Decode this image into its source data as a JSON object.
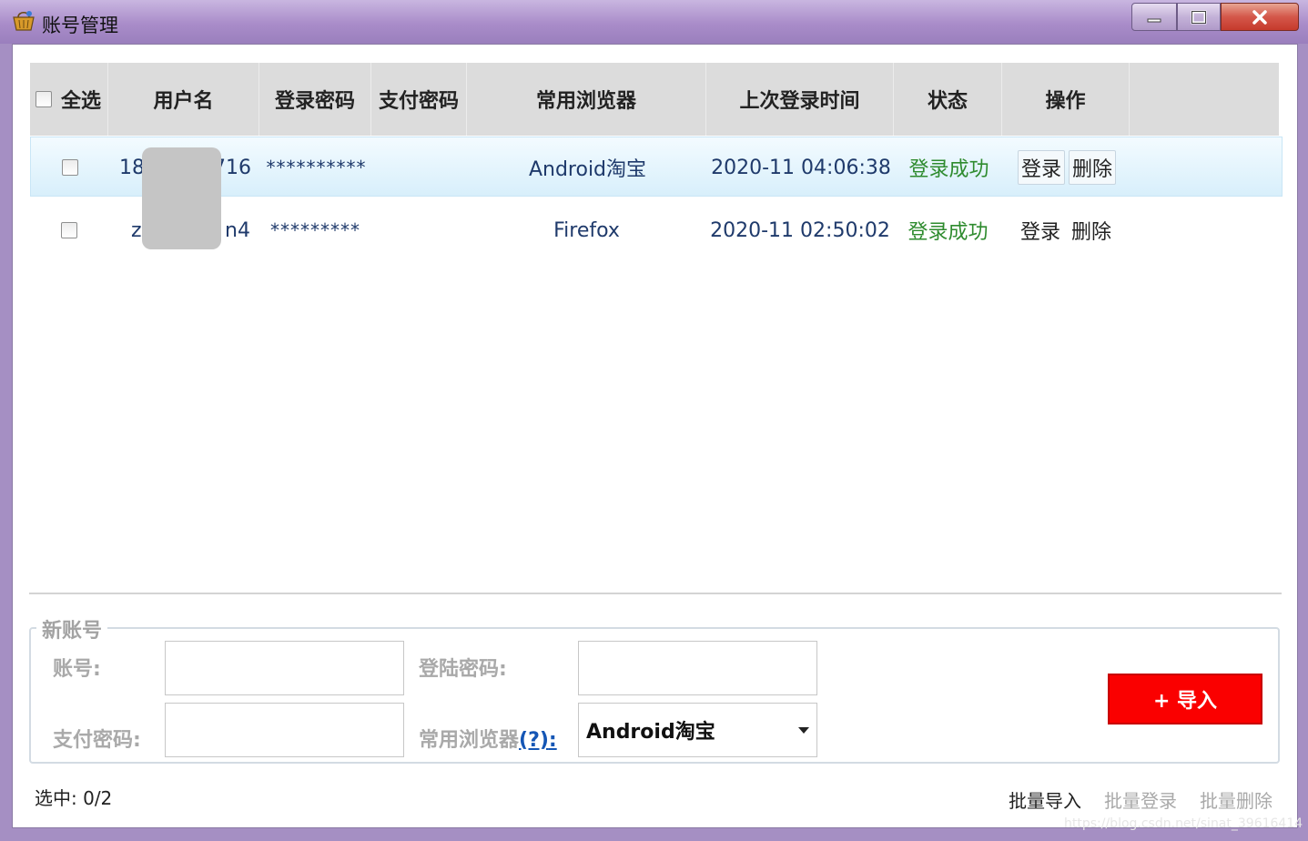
{
  "window": {
    "title": "账号管理",
    "controls": {
      "minimize": "—",
      "maximize": "▢",
      "close": "✕"
    },
    "title_icon": "basket-icon"
  },
  "table": {
    "headers": {
      "select_all": "全选",
      "username": "用户名",
      "login_password": "登录密码",
      "pay_password": "支付密码",
      "browser": "常用浏览器",
      "last_login": "上次登录时间",
      "status": "状态",
      "actions": "操作"
    },
    "rows": [
      {
        "username_start": "18",
        "username_end": "716",
        "login_password": "**********",
        "pay_password": "",
        "browser": "Android淘宝",
        "last_login": "2020-11 04:06:38",
        "status": "登录成功",
        "login_btn": "登录",
        "delete_btn": "删除"
      },
      {
        "username_start": "z",
        "username_end": "n4",
        "login_password": "*********",
        "pay_password": "",
        "browser": "Firefox",
        "last_login": "2020-11 02:50:02",
        "status": "登录成功",
        "login_btn": "登录",
        "delete_btn": "删除"
      }
    ]
  },
  "new_account": {
    "legend": "新账号",
    "account_label": "账号:",
    "login_pwd_label": "登陆密码:",
    "pay_pwd_label": "支付密码:",
    "browser_label": "常用浏览器",
    "help_link": "(?)",
    "help_colon": ":",
    "browser_selected": "Android淘宝",
    "import_button": "+ 导入"
  },
  "footer": {
    "selected_count": "选中: 0/2",
    "batch_import": "批量导入",
    "batch_login": "批量登录",
    "batch_delete": "批量删除",
    "watermark": "https://blog.csdn.net/sinat_39616414"
  },
  "colors": {
    "status_success": "#2e8b2e",
    "import_button": "#fa0000",
    "link": "#1556b5"
  }
}
